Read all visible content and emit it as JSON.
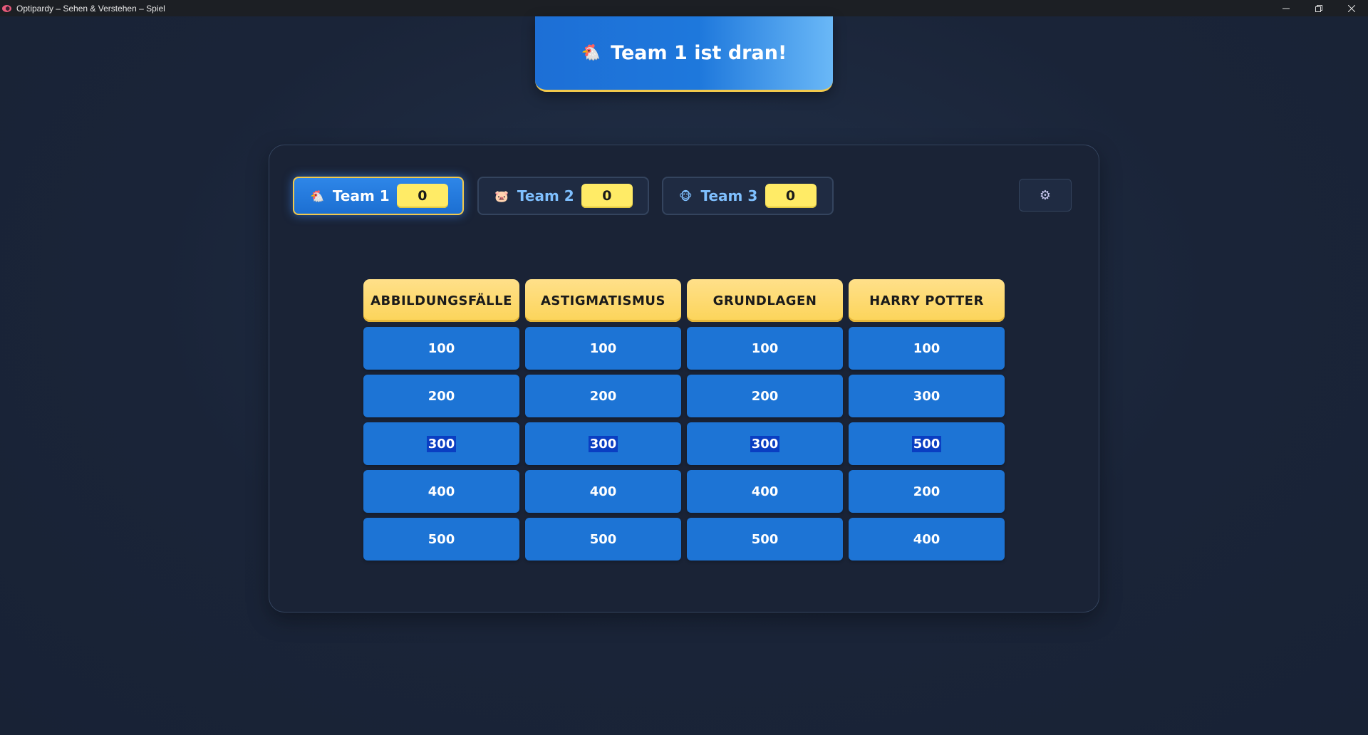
{
  "window": {
    "title": "Optipardy – Sehen & Verstehen – Spiel"
  },
  "turn": {
    "emoji": "🐔",
    "text": "Team 1 ist dran!"
  },
  "teams": [
    {
      "emoji": "🐔",
      "name": "Team 1",
      "score": "0",
      "active": true
    },
    {
      "emoji": "🐷",
      "name": "Team 2",
      "score": "0",
      "active": false
    },
    {
      "emoji": "🐵",
      "name": "Team 3",
      "score": "0",
      "active": false
    }
  ],
  "settings": {
    "icon": "⚙"
  },
  "board": {
    "categories": [
      "ABBILDUNGSFÄLLE",
      "ASTIGMATISMUS",
      "GRUNDLAGEN",
      "HARRY POTTER"
    ],
    "columns": [
      [
        "100",
        "200",
        "300",
        "400",
        "500"
      ],
      [
        "100",
        "200",
        "300",
        "400",
        "500"
      ],
      [
        "100",
        "200",
        "300",
        "400",
        "500"
      ],
      [
        "100",
        "300",
        "500",
        "200",
        "400"
      ]
    ],
    "selected_row": 2
  },
  "colors": {
    "accent": "#1d74d5",
    "category": "#fcd459",
    "score": "#ffeb66",
    "active_border": "#f2c94c"
  }
}
